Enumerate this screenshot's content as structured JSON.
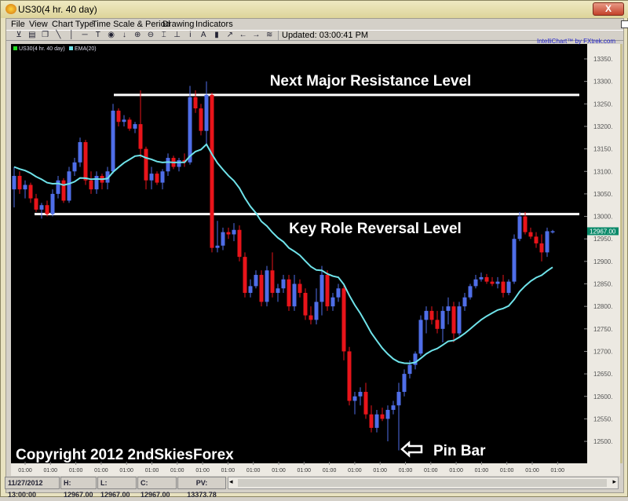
{
  "window": {
    "title": "US30(4 hr.  40 day)",
    "close": "X"
  },
  "menu": [
    "File",
    "View",
    "Chart Type",
    "Time Scale & Period",
    "Drawing",
    "Indicators"
  ],
  "toolbar": {
    "icons": [
      "chart-icon",
      "print-icon",
      "copy-icon",
      "trendline-icon",
      "vertical-line-icon",
      "horizontal-line-icon",
      "text-icon",
      "circle-icon",
      "arrow-down-icon",
      "zoom-in-icon",
      "zoom-out-icon",
      "fit-icon",
      "baseline-icon",
      "info-icon",
      "font-icon",
      "bar-chart-icon",
      "indicator-icon",
      "left-arrow-icon",
      "right-arrow-icon",
      "settings-icon"
    ],
    "updated": "Updated: 03:00:41 PM"
  },
  "brand": "IntelliChart™ by FXtrek.com",
  "legend": {
    "series": "US30(4 hr.  40 day)",
    "ema": "EMA(20)"
  },
  "colors": {
    "up": "#4f6ee8",
    "down": "#e8141a",
    "ema": "#6fe3ea",
    "price_tag": "#0b8a6a",
    "legend_series": "#22dd22"
  },
  "chart_data": {
    "type": "candlestick",
    "ylim": [
      12450,
      13380
    ],
    "yticks": [
      13350,
      13300,
      13250,
      13200,
      13150,
      13100,
      13050,
      13000,
      12950,
      12900,
      12850,
      12800,
      12750,
      12700,
      12650,
      12600,
      12550,
      12500
    ],
    "ytick_suffix": ".",
    "xticks": [
      "01:00",
      "01:00",
      "01:00",
      "01:00",
      "01:00",
      "01:00",
      "01:00",
      "01:00",
      "01:00",
      "01:00",
      "01:00",
      "01:00",
      "01:00",
      "01:00",
      "01:00",
      "01:00",
      "01:00",
      "01:00",
      "01:00",
      "01:00",
      "01:00",
      "01:00"
    ],
    "last_price": "12967.00",
    "ema_period": 20,
    "ohlc": [
      [
        13060,
        13110,
        13020,
        13090
      ],
      [
        13090,
        13100,
        13050,
        13060
      ],
      [
        13060,
        13080,
        13040,
        13070
      ],
      [
        13070,
        13075,
        13030,
        13040
      ],
      [
        13040,
        13050,
        13010,
        13015
      ],
      [
        13015,
        13030,
        12995,
        13025
      ],
      [
        13025,
        13035,
        13000,
        13005
      ],
      [
        13005,
        13060,
        13000,
        13050
      ],
      [
        13050,
        13090,
        13040,
        13080
      ],
      [
        13080,
        13085,
        13030,
        13035
      ],
      [
        13035,
        13110,
        13030,
        13100
      ],
      [
        13100,
        13130,
        13090,
        13120
      ],
      [
        13120,
        13175,
        13110,
        13165
      ],
      [
        13165,
        13170,
        13070,
        13080
      ],
      [
        13080,
        13100,
        13050,
        13060
      ],
      [
        13060,
        13100,
        13050,
        13090
      ],
      [
        13090,
        13095,
        13060,
        13075
      ],
      [
        13075,
        13110,
        13060,
        13100
      ],
      [
        13100,
        13250,
        13095,
        13235
      ],
      [
        13235,
        13240,
        13200,
        13210
      ],
      [
        13210,
        13225,
        13200,
        13215
      ],
      [
        13215,
        13220,
        13190,
        13195
      ],
      [
        13195,
        13210,
        13185,
        13205
      ],
      [
        13205,
        13280,
        13130,
        13150
      ],
      [
        13150,
        13155,
        13060,
        13080
      ],
      [
        13080,
        13110,
        13060,
        13095
      ],
      [
        13095,
        13100,
        13070,
        13075
      ],
      [
        13075,
        13105,
        13060,
        13100
      ],
      [
        13100,
        13140,
        13090,
        13130
      ],
      [
        13130,
        13135,
        13105,
        13110
      ],
      [
        13110,
        13130,
        13100,
        13125
      ],
      [
        13125,
        13140,
        13110,
        13120
      ],
      [
        13120,
        13290,
        13115,
        13265
      ],
      [
        13265,
        13280,
        13230,
        13240
      ],
      [
        13240,
        13250,
        13180,
        13190
      ],
      [
        13190,
        13300,
        13160,
        13270
      ],
      [
        13270,
        13275,
        12920,
        12930
      ],
      [
        12930,
        12990,
        12920,
        12935
      ],
      [
        12935,
        12975,
        12925,
        12965
      ],
      [
        12965,
        12975,
        12950,
        12960
      ],
      [
        12960,
        12985,
        12945,
        12970
      ],
      [
        12970,
        12980,
        12900,
        12910
      ],
      [
        12910,
        12920,
        12820,
        12830
      ],
      [
        12830,
        12860,
        12820,
        12845
      ],
      [
        12845,
        12880,
        12840,
        12870
      ],
      [
        12870,
        12880,
        12800,
        12810
      ],
      [
        12810,
        12890,
        12800,
        12880
      ],
      [
        12880,
        12920,
        12820,
        12830
      ],
      [
        12830,
        12850,
        12810,
        12840
      ],
      [
        12840,
        12870,
        12830,
        12860
      ],
      [
        12860,
        12870,
        12790,
        12800
      ],
      [
        12800,
        12870,
        12790,
        12850
      ],
      [
        12850,
        12860,
        12820,
        12830
      ],
      [
        12830,
        12840,
        12770,
        12780
      ],
      [
        12780,
        12800,
        12760,
        12770
      ],
      [
        12770,
        12840,
        12760,
        12810
      ],
      [
        12810,
        12890,
        12780,
        12870
      ],
      [
        12870,
        12880,
        12790,
        12800
      ],
      [
        12800,
        12830,
        12790,
        12820
      ],
      [
        12820,
        12850,
        12810,
        12840
      ],
      [
        12840,
        12850,
        12680,
        12700
      ],
      [
        12700,
        12710,
        12580,
        12590
      ],
      [
        12590,
        12610,
        12560,
        12600
      ],
      [
        12600,
        12620,
        12580,
        12610
      ],
      [
        12610,
        12630,
        12550,
        12560
      ],
      [
        12560,
        12580,
        12520,
        12530
      ],
      [
        12530,
        12570,
        12520,
        12560
      ],
      [
        12560,
        12575,
        12545,
        12550
      ],
      [
        12550,
        12580,
        12500,
        12570
      ],
      [
        12570,
        12590,
        12560,
        12580
      ],
      [
        12580,
        12630,
        12480,
        12610
      ],
      [
        12610,
        12660,
        12600,
        12650
      ],
      [
        12650,
        12680,
        12640,
        12670
      ],
      [
        12670,
        12700,
        12660,
        12695
      ],
      [
        12695,
        12780,
        12690,
        12770
      ],
      [
        12770,
        12800,
        12740,
        12790
      ],
      [
        12790,
        12800,
        12760,
        12770
      ],
      [
        12770,
        12790,
        12740,
        12750
      ],
      [
        12750,
        12800,
        12720,
        12790
      ],
      [
        12790,
        12820,
        12760,
        12800
      ],
      [
        12800,
        12810,
        12720,
        12740
      ],
      [
        12740,
        12810,
        12735,
        12800
      ],
      [
        12800,
        12830,
        12790,
        12820
      ],
      [
        12820,
        12850,
        12815,
        12845
      ],
      [
        12845,
        12870,
        12840,
        12860
      ],
      [
        12860,
        12875,
        12855,
        12865
      ],
      [
        12865,
        12872,
        12850,
        12855
      ],
      [
        12855,
        12865,
        12845,
        12850
      ],
      [
        12850,
        12865,
        12840,
        12855
      ],
      [
        12855,
        12870,
        12820,
        12830
      ],
      [
        12830,
        12860,
        12825,
        12855
      ],
      [
        12855,
        12960,
        12850,
        12950
      ],
      [
        12950,
        13010,
        12945,
        13000
      ],
      [
        13000,
        13010,
        12960,
        12965
      ],
      [
        12965,
        12975,
        12950,
        12955
      ],
      [
        12955,
        12965,
        12930,
        12940
      ],
      [
        12940,
        12960,
        12900,
        12920
      ],
      [
        12920,
        12975,
        12910,
        12967
      ],
      [
        12967,
        12970,
        12962,
        12967
      ]
    ],
    "levels": [
      {
        "label": "Next Major Resistance Level",
        "price": 13270
      },
      {
        "label": "Key Role Reversal Level",
        "price": 13005
      }
    ],
    "annotations": {
      "pin_bar": "Pin Bar",
      "copyright": "Copyright 2012 2ndSkiesForex"
    }
  },
  "status": {
    "datetime": "11/27/2012 13:00:00",
    "high": "H: 12967.00",
    "low": "L: 12967.00",
    "close": "C: 12967.00",
    "pv": "PV: 13373.78"
  }
}
